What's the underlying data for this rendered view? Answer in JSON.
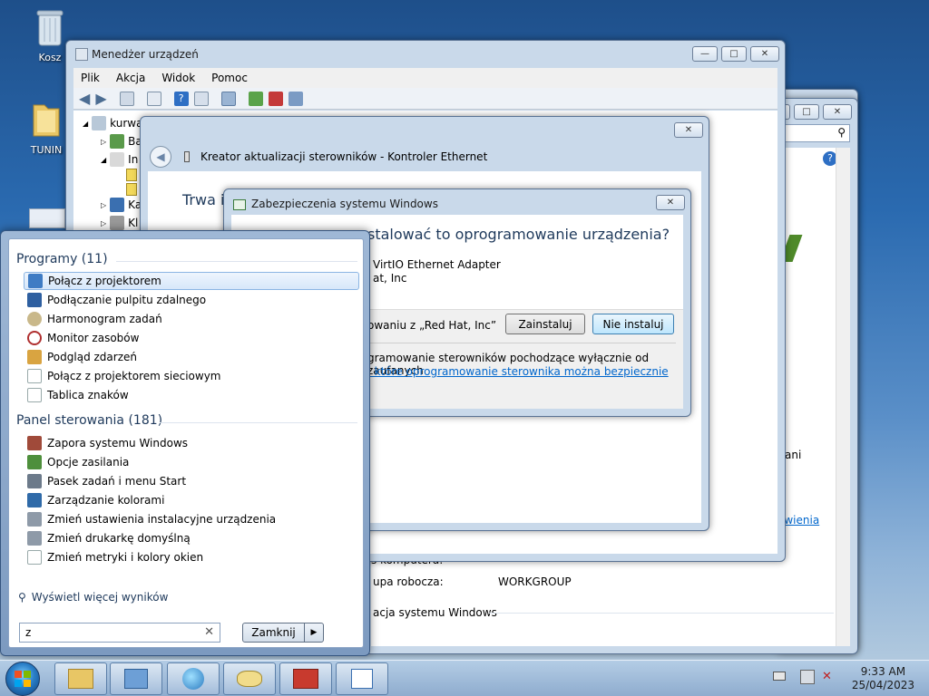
{
  "desktop": {
    "icons": [
      {
        "label": "Kosz",
        "icon": "recycle-bin-icon"
      },
      {
        "label": "TUNIN",
        "icon": "folder-icon"
      }
    ]
  },
  "device_manager": {
    "title": "Menedżer urządzeń",
    "menu": [
      "Plik",
      "Akcja",
      "Widok",
      "Pomoc"
    ],
    "tree": {
      "root": "kurwa",
      "items": [
        "Ba",
        "In",
        "Ka",
        "Kl"
      ]
    }
  },
  "wizard": {
    "title": "Kreator aktualizacji sterowników - Kontroler Ethernet",
    "heading": "Trwa in"
  },
  "security": {
    "title": "Zabezpieczenia systemu Windows",
    "question": "stalować to oprogramowanie urządzenia?",
    "name_line": "VirtIO Ethernet Adapter",
    "publisher_line": "at, Inc",
    "trust_text": "owaniu z „Red Hat, Inc”",
    "install_label": "Zainstaluj",
    "dont_install_label": "Nie instaluj",
    "footer_text": "gramowanie sterowników pochodzące wyłącznie od zaufanych",
    "footer_link": ", które oprogramowanie sterownika można bezpiecznie"
  },
  "system_window": {
    "texts": {
      "computer_row": "s komputera:",
      "workgroup_label": "upa robocza:",
      "workgroup_value": "WORKGROUP",
      "activation": "acja systemu Windows",
      "side_text": "ani",
      "side_link": "awienia"
    }
  },
  "start_menu": {
    "programs_header": "Programy (11)",
    "programs": [
      {
        "label": "Połącz z projektorem",
        "icon": "projector-icon",
        "selected": true
      },
      {
        "label": "Podłączanie pulpitu zdalnego",
        "icon": "remote-desktop-icon",
        "selected": false
      },
      {
        "label": "Harmonogram zadań",
        "icon": "clock-icon",
        "selected": false
      },
      {
        "label": "Monitor zasobów",
        "icon": "resource-monitor-icon",
        "selected": false
      },
      {
        "label": "Podgląd zdarzeń",
        "icon": "event-viewer-icon",
        "selected": false
      },
      {
        "label": "Połącz z projektorem sieciowym",
        "icon": "document-icon",
        "selected": false
      },
      {
        "label": "Tablica znaków",
        "icon": "document-icon",
        "selected": false
      }
    ],
    "control_panel_header": "Panel sterowania (181)",
    "control_panel": [
      {
        "label": "Zapora systemu Windows",
        "icon": "firewall-icon"
      },
      {
        "label": "Opcje zasilania",
        "icon": "power-icon"
      },
      {
        "label": "Pasek zadań i menu Start",
        "icon": "taskbar-icon"
      },
      {
        "label": "Zarządzanie kolorami",
        "icon": "color-icon"
      },
      {
        "label": "Zmień ustawienia instalacyjne urządzenia",
        "icon": "printer-icon"
      },
      {
        "label": "Zmień drukarkę domyślną",
        "icon": "printer-icon"
      },
      {
        "label": "Zmień metryki i kolory okien",
        "icon": "document-icon"
      }
    ],
    "more_results": "Wyświetl więcej wyników",
    "search_value": "z",
    "shutdown_label": "Zamknij"
  },
  "taskbar": {
    "clock_time": "9:33 AM",
    "clock_date": "25/04/2023"
  }
}
